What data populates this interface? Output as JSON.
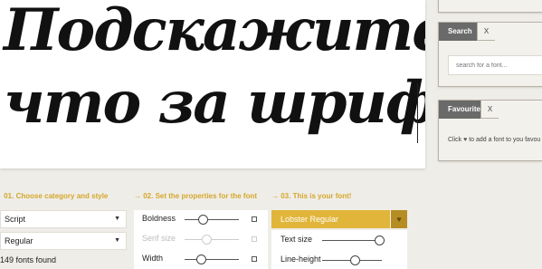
{
  "preview": {
    "line1": "Подскажите,",
    "line2": "что за шрифт"
  },
  "search_panel": {
    "tab": "Search",
    "close": "X",
    "placeholder": "search for a font..."
  },
  "favourites_panel": {
    "tab": "Favourites",
    "close": "X",
    "text_before": "Click",
    "heart": "♥",
    "text_after": "to add a font to you favou"
  },
  "steps": {
    "step1": "→ 01. Choose category and style",
    "step2": "→ 02. Set the properties for the font",
    "step3": "→ 03. This is your font!"
  },
  "category_select": {
    "value": "Script",
    "arrow": "▼"
  },
  "style_select": {
    "value": "Regular",
    "arrow": "▼"
  },
  "count": "149 fonts found",
  "properties": [
    {
      "label": "Boldness",
      "value": 0.33,
      "enabled": true
    },
    {
      "label": "Serif size",
      "value": 0.4,
      "enabled": false
    },
    {
      "label": "Width",
      "value": 0.3,
      "enabled": true
    }
  ],
  "result": {
    "font_name": "Lobster Regular",
    "fav_icon": "♥",
    "text_size_label": "Text size",
    "text_size_value": 0.95,
    "line_height_label": "Line-height",
    "line_height_value": 0.55
  },
  "colors": {
    "accent": "#e0b53a",
    "accent_dark": "#b58d23",
    "tab": "#6a6a6a",
    "background": "#efede8"
  }
}
